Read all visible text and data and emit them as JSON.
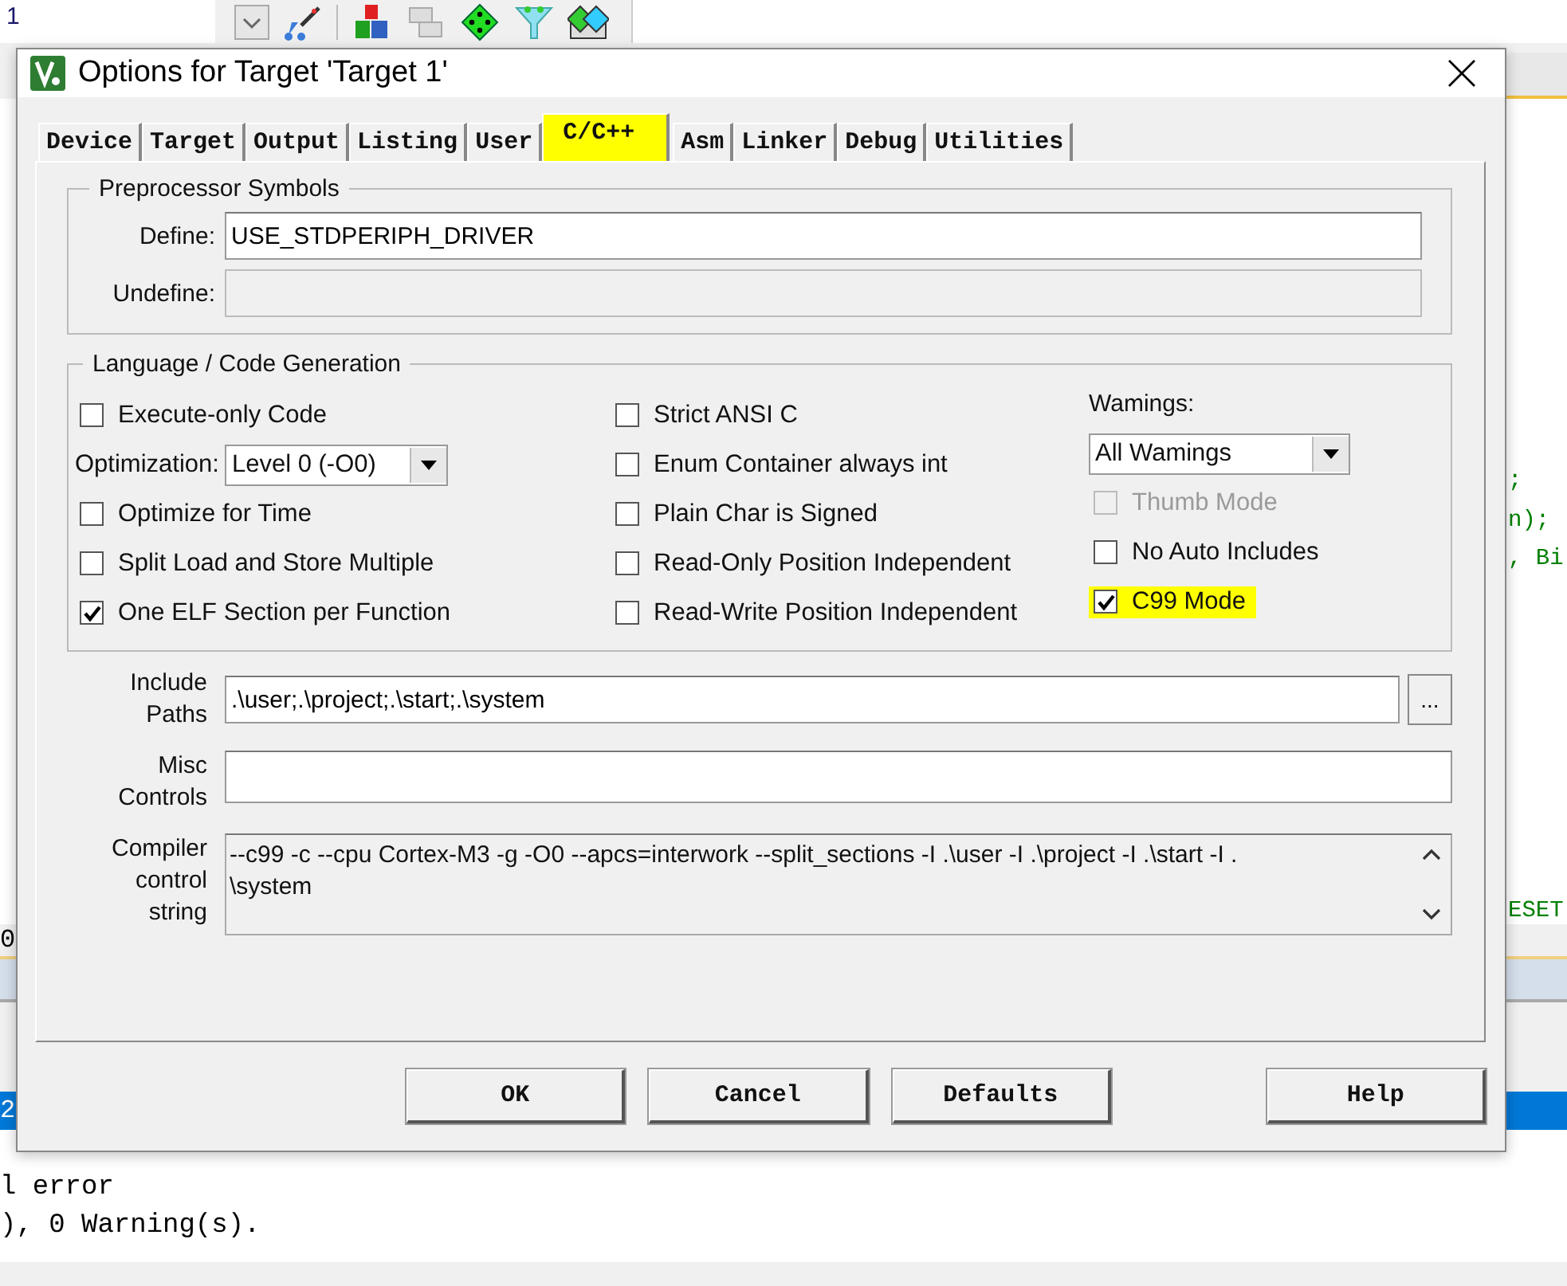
{
  "ide": {
    "toolbar_field": "1",
    "editor_lines": [
      ";",
      "n);",
      ", Bi",
      "ESET"
    ],
    "side_fragments": [
      "0",
      "2"
    ],
    "output_lines": [
      "l error",
      "), 0 Warning(s)."
    ]
  },
  "dialog": {
    "title": "Options for Target 'Target 1'",
    "tabs": [
      {
        "label": "Device",
        "selected": false,
        "highlighted": false
      },
      {
        "label": "Target",
        "selected": false,
        "highlighted": false
      },
      {
        "label": "Output",
        "selected": false,
        "highlighted": false
      },
      {
        "label": "Listing",
        "selected": false,
        "highlighted": false
      },
      {
        "label": "User",
        "selected": false,
        "highlighted": false
      },
      {
        "label": "C/C++",
        "selected": true,
        "highlighted": true
      },
      {
        "label": "Asm",
        "selected": false,
        "highlighted": false
      },
      {
        "label": "Linker",
        "selected": false,
        "highlighted": false
      },
      {
        "label": "Debug",
        "selected": false,
        "highlighted": false
      },
      {
        "label": "Utilities",
        "selected": false,
        "highlighted": false
      }
    ],
    "preprocessor": {
      "title": "Preprocessor Symbols",
      "fields": [
        {
          "label": "Define:",
          "value": "USE_STDPERIPH_DRIVER",
          "disabled": false
        },
        {
          "label": "Undefine:",
          "disabled": true
        }
      ]
    },
    "language": {
      "title": "Language / Code Generation",
      "columns": [
        [
          {
            "kind": "checkbox",
            "label": "Execute-only Code",
            "checked": false,
            "disabled": false,
            "highlighted": false
          },
          {
            "kind": "select",
            "label": "Optimization:",
            "value": "Level 0 (-O0)"
          },
          {
            "kind": "checkbox",
            "label": "Optimize for Time",
            "checked": false,
            "disabled": false,
            "highlighted": false
          },
          {
            "kind": "checkbox",
            "label": "Split Load and Store Multiple",
            "checked": false,
            "disabled": false,
            "highlighted": false
          },
          {
            "kind": "checkbox",
            "label": "One ELF Section per Function",
            "checked": true,
            "disabled": false,
            "highlighted": false
          }
        ],
        [
          {
            "kind": "checkbox",
            "label": "Strict ANSI C",
            "checked": false,
            "disabled": false,
            "highlighted": false
          },
          {
            "kind": "checkbox",
            "label": "Enum Container always int",
            "checked": false,
            "disabled": false,
            "highlighted": false
          },
          {
            "kind": "checkbox",
            "label": "Plain Char is Signed",
            "checked": false,
            "disabled": false,
            "highlighted": false
          },
          {
            "kind": "checkbox",
            "label": "Read-Only Position Independent",
            "checked": false,
            "disabled": false,
            "highlighted": false
          },
          {
            "kind": "checkbox",
            "label": "Read-Write Position Independent",
            "checked": false,
            "disabled": false,
            "highlighted": false
          }
        ],
        [
          {
            "kind": "heading",
            "label": "Wamings:"
          },
          {
            "kind": "select",
            "value": "All Wamings"
          },
          {
            "kind": "checkbox",
            "label": "Thumb Mode",
            "checked": false,
            "disabled": true,
            "highlighted": false
          },
          {
            "kind": "checkbox",
            "label": "No Auto Includes",
            "checked": false,
            "disabled": false,
            "highlighted": false
          },
          {
            "kind": "checkbox",
            "label": "C99 Mode",
            "checked": true,
            "disabled": false,
            "highlighted": true
          }
        ]
      ]
    },
    "include_paths": {
      "label_lines": [
        "Include",
        "Paths"
      ],
      "value": ".\\user;.\\project;.\\start;.\\system",
      "browse": "..."
    },
    "misc_controls": {
      "label_lines": [
        "Misc",
        "Controls"
      ]
    },
    "compiler_string": {
      "label_lines": [
        "Compiler",
        "control",
        "string"
      ],
      "lines": [
        "--c99 -c --cpu Cortex-M3 -g -O0 --apcs=interwork --split_sections -I .\\user -I .\\project -I .\\start -I .",
        "\\system"
      ]
    },
    "buttons": [
      "OK",
      "Cancel",
      "Defaults",
      "Help"
    ]
  }
}
